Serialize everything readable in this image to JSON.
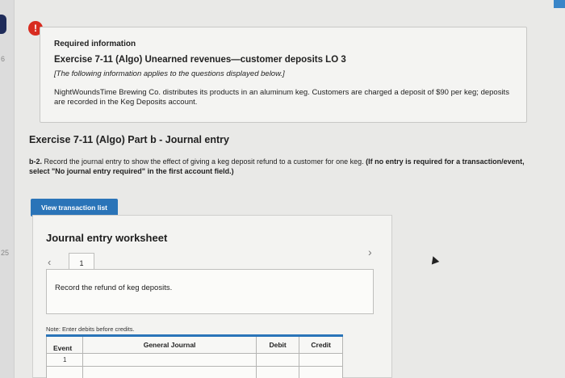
{
  "sidebar": {
    "numbers": [
      "6",
      "25"
    ]
  },
  "info": {
    "required_label": "Required information",
    "exercise_title": "Exercise 7-11 (Algo) Unearned revenues—customer deposits LO 3",
    "note": "[The following information applies to the questions displayed below.]",
    "description": "NightWoundsTime Brewing Co. distributes its products in an aluminum keg. Customers are charged a deposit of $90 per keg; deposits are recorded in the Keg Deposits account."
  },
  "part": {
    "title": "Exercise 7-11 (Algo) Part b - Journal entry",
    "instruction_prefix": "b-2.",
    "instruction_text": "Record the journal entry to show the effect of giving a keg deposit refund to a customer for one keg.",
    "instruction_bold": "(If no entry is required for a transaction/event, select \"No journal entry required\" in the first account field.)"
  },
  "buttons": {
    "view_transaction": "View transaction list"
  },
  "worksheet": {
    "title": "Journal entry worksheet",
    "page_number": "1",
    "record_text": "Record the refund of keg deposits.",
    "note": "Note: Enter debits before credits.",
    "columns": [
      "Event",
      "General Journal",
      "Debit",
      "Credit"
    ],
    "rows": [
      {
        "event": "1",
        "account": "",
        "debit": "",
        "credit": ""
      }
    ]
  },
  "colors": {
    "accent": "#2a74b8",
    "alert": "#d82c20"
  }
}
